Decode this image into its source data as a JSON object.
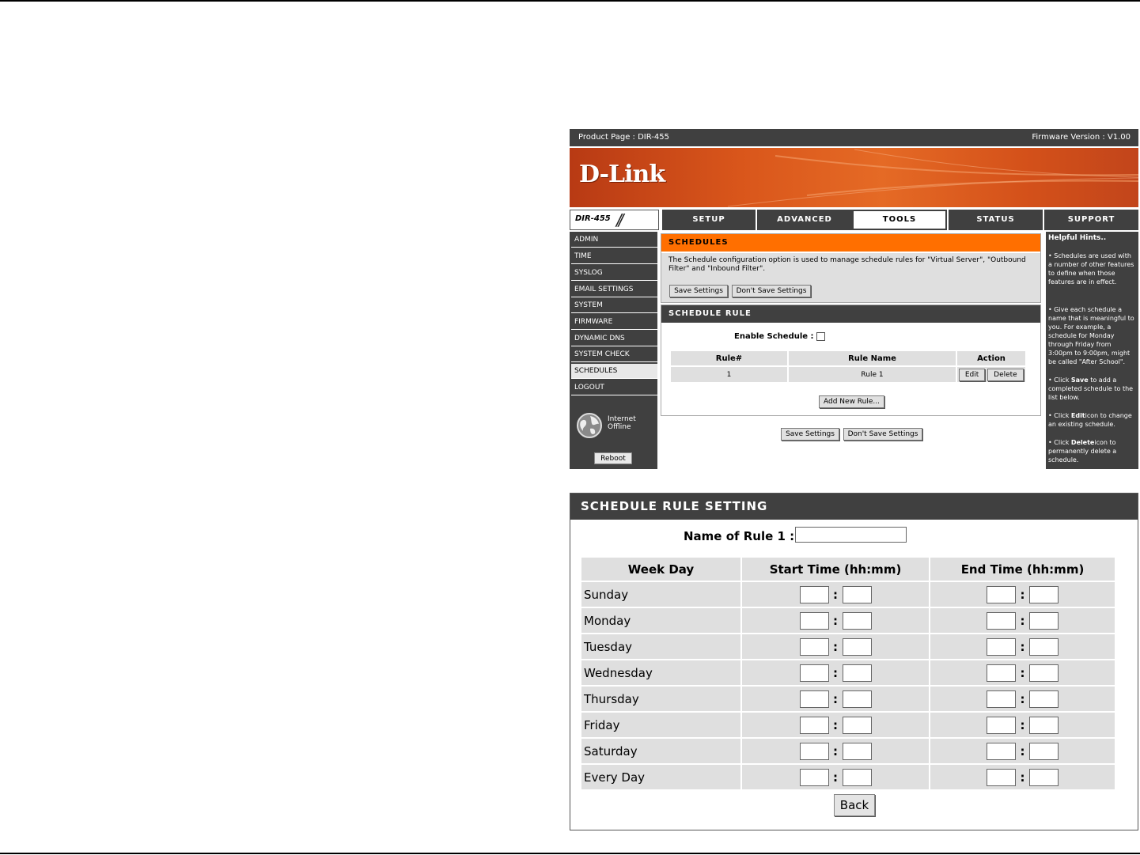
{
  "topbar": {
    "product": "Product Page :  DIR-455",
    "firmware": "Firmware Version : V1.00"
  },
  "brand": {
    "logo": "D-Link",
    "model": "DIR-455"
  },
  "colors": {
    "accent": "#ff6f00",
    "dark": "#404040",
    "panel": "#dfdfdf"
  },
  "nav": {
    "tabs": [
      "SETUP",
      "ADVANCED",
      "TOOLS",
      "STATUS",
      "SUPPORT"
    ],
    "active": "TOOLS"
  },
  "sidebar": {
    "items": [
      "ADMIN",
      "TIME",
      "SYSLOG",
      "EMAIL SETTINGS",
      "SYSTEM",
      "FIRMWARE",
      "DYNAMIC DNS",
      "SYSTEM CHECK",
      "SCHEDULES",
      "LOGOUT"
    ],
    "active": "SCHEDULES",
    "status_line1": "Internet",
    "status_line2": "Offline",
    "reboot": "Reboot",
    "status_icon": "globe-icon"
  },
  "schedules": {
    "title": "SCHEDULES",
    "description": "The Schedule configuration option is used to manage schedule rules for \"Virtual Server\", \"Outbound Filter\" and \"Inbound Filter\".",
    "save": "Save Settings",
    "dont_save": "Don't Save Settings"
  },
  "schedule_rule": {
    "title": "SCHEDULE RULE",
    "enable_label": "Enable Schedule :",
    "columns": [
      "Rule#",
      "Rule Name",
      "Action"
    ],
    "rows": [
      {
        "num": "1",
        "name": "Rule 1",
        "edit": "Edit",
        "delete": "Delete"
      }
    ],
    "add": "Add New Rule...",
    "save": "Save Settings",
    "dont_save": "Don't Save Settings"
  },
  "hints": {
    "title": "Helpful Hints..",
    "h1": "• Schedules are used with a number of other features to define when those features are in effect.",
    "h2": "• Give each schedule a name that is meaningful to you. For example, a schedule for Monday through Friday from 3:00pm to 9:00pm, might be called \"After School\".",
    "h3_pre": "• Click ",
    "h3_bold": "Save",
    "h3_post": " to add a completed schedule to the list below.",
    "h4_pre": "• Click ",
    "h4_bold": "Edit",
    "h4_post": "icon to change an existing schedule.",
    "h5_pre": "• Click ",
    "h5_bold": "Delete",
    "h5_post": "icon to permanently delete a schedule."
  },
  "rule_setting": {
    "title": "SCHEDULE RULE SETTING",
    "name_label": "Name of Rule 1 :",
    "columns": [
      "Week Day",
      "Start Time (hh:mm)",
      "End Time (hh:mm)"
    ],
    "days": [
      "Sunday",
      "Monday",
      "Tuesday",
      "Wednesday",
      "Thursday",
      "Friday",
      "Saturday",
      "Every Day"
    ],
    "separator": ":",
    "back": "Back"
  }
}
